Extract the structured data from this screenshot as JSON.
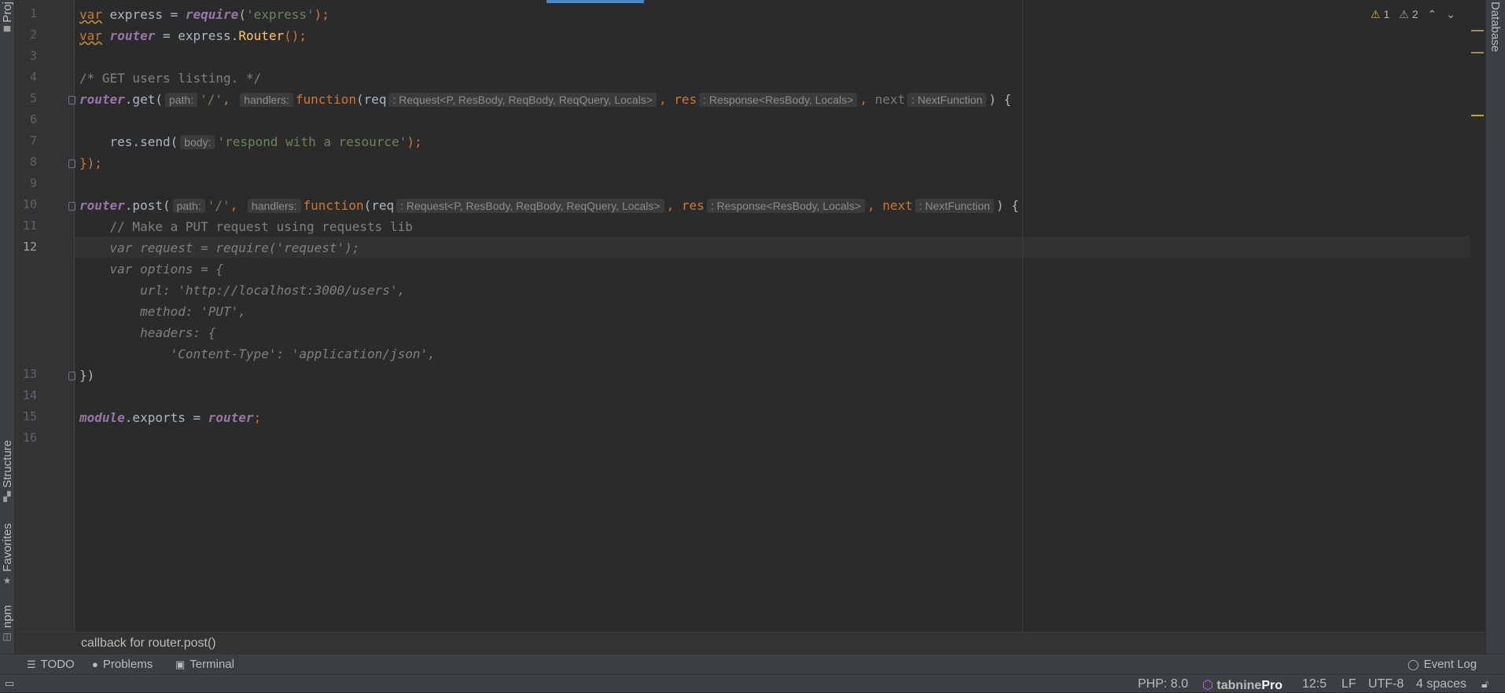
{
  "left_tools": [
    {
      "label": "Proj",
      "icon": "folder-icon"
    },
    {
      "label": "Structure",
      "icon": "structure-icon"
    },
    {
      "label": "Favorites",
      "icon": "star-icon"
    },
    {
      "label": "npm",
      "icon": "npm-icon"
    }
  ],
  "right_tools": [
    {
      "label": "Database"
    }
  ],
  "inspections": {
    "warnings_yellow": "1",
    "warnings_grey": "2"
  },
  "gutter": {
    "line_numbers": [
      "1",
      "2",
      "3",
      "4",
      "5",
      "6",
      "7",
      "8",
      "9",
      "10",
      "11",
      "12",
      "",
      "",
      "",
      "",
      "",
      "13",
      "14",
      "15",
      "16"
    ],
    "active_line": "12"
  },
  "code": {
    "l1": {
      "kw": "var",
      "name": " express = ",
      "req": "require",
      "p1": "(",
      "str": "'express'",
      "p2": ");"
    },
    "l2": {
      "kw": "var",
      "sp": " ",
      "name": "router",
      "eq": " = express.",
      "fn": "Router",
      "p": "();"
    },
    "l4": {
      "cmt": "/* GET users listing. */"
    },
    "l5": {
      "obj": "router",
      "dot": ".get(",
      "hint_path": "path:",
      "str": "'/'",
      "c1": ",",
      "hint_handlers": "handlers:",
      "fn": "function",
      "p1": "(req",
      "hint_req": ": Request<P, ResBody, ReqBody, ReqQuery, Locals>",
      "c2": ", res",
      "hint_res": ": Response<ResBody, Locals>",
      "c3": ",",
      "next": " next",
      "hint_next": ": NextFunction",
      "end": ") {"
    },
    "l7": {
      "pre": "    res.send(",
      "hint_body": "body:",
      "str": "'respond with a resource'",
      "end": ");"
    },
    "l8": {
      "text": "});"
    },
    "l10": {
      "obj": "router",
      "dot": ".post(",
      "hint_path": "path:",
      "str": "'/'",
      "c1": ",",
      "hint_handlers": "handlers:",
      "fn": "function",
      "p1": "(req",
      "hint_req": ": Request<P, ResBody, ReqBody, ReqQuery, Locals>",
      "c2": ", res",
      "hint_res": ": Response<ResBody, Locals>",
      "c3": ", next",
      "hint_next": ": NextFunction",
      "end": ") {"
    },
    "l11": {
      "cmt": "    // Make a PUT request using requests lib"
    },
    "l12": {
      "text": "    var request = require('request');"
    },
    "l12b": {
      "text": "    var options = {"
    },
    "l12c": {
      "text": "        url: 'http://localhost:3000/users',"
    },
    "l12d": {
      "text": "        method: 'PUT',"
    },
    "l12e": {
      "text": "        headers: {"
    },
    "l12f": {
      "text": "            'Content-Type': 'application/json',"
    },
    "l13": {
      "text": "})"
    },
    "l15": {
      "obj": "module",
      "mid": ".exports = ",
      "var": "router",
      "end": ";"
    }
  },
  "breadcrumb": "callback for router.post()",
  "tool_windows": [
    {
      "label": "TODO",
      "icon": "list-icon"
    },
    {
      "label": "Problems",
      "icon": "info-icon"
    },
    {
      "label": "Terminal",
      "icon": "terminal-icon"
    }
  ],
  "event_log": "Event Log",
  "status": {
    "php": "PHP: 8.0",
    "tabnine": "tabnine",
    "tabnine_pro": "Pro",
    "position": "12:5",
    "line_sep": "LF",
    "encoding": "UTF-8",
    "indent": "4 spaces"
  },
  "colors": {
    "accent": "#4a88c7",
    "keyword": "#cc7832",
    "string": "#6a8759",
    "function": "#ffc66d",
    "variable": "#9876aa",
    "warning": "#e3b341"
  }
}
